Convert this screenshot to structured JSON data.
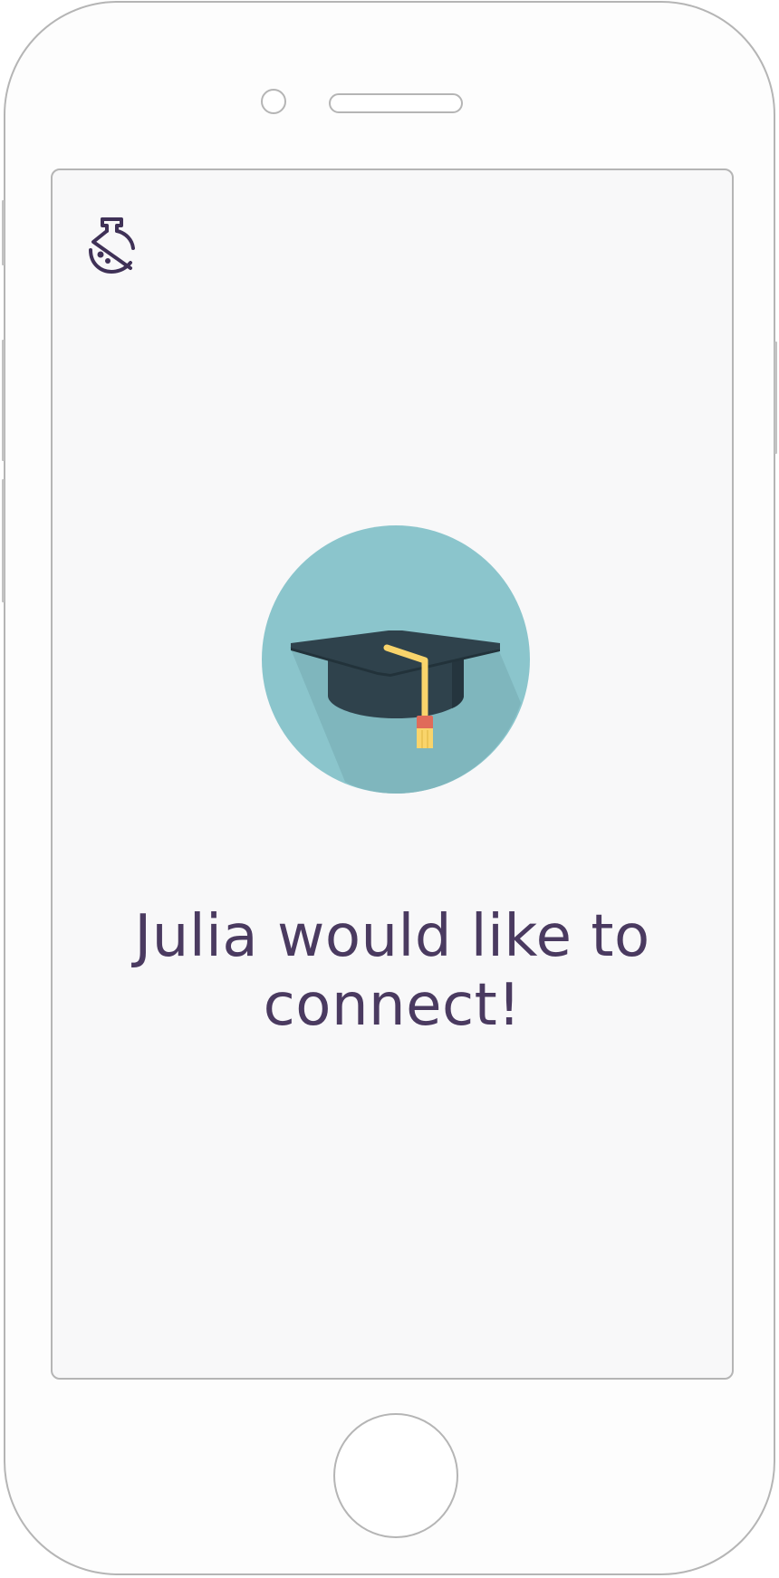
{
  "device": {
    "frame_color": "#b5b5b5",
    "screen_background": "#f8f8f9"
  },
  "header": {
    "logo_icon": "flask-logo-icon",
    "logo_color": "#3f3157"
  },
  "hero": {
    "icon": "graduation-cap-icon",
    "circle_color": "#8bc5cc",
    "cap_color": "#2f424c",
    "tassel_color": "#f9d46b"
  },
  "main": {
    "message": "Julia would like to connect!",
    "text_color": "#4a3a60"
  }
}
